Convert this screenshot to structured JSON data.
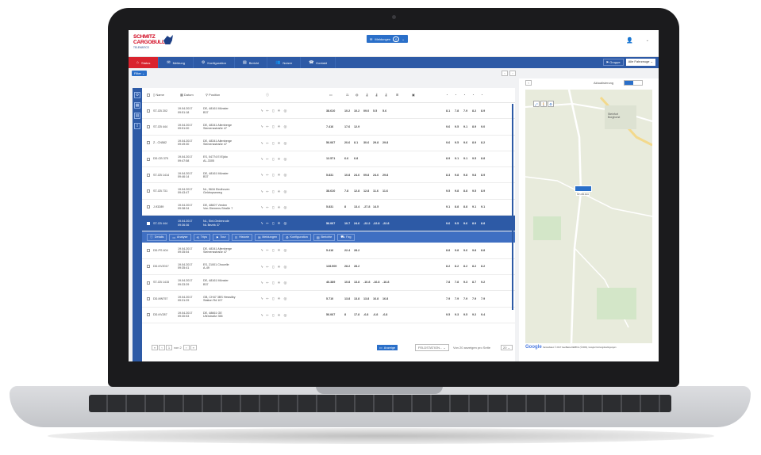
{
  "app": {
    "logo_line1": "SCHMITZ",
    "logo_line2": "CARGOBULL",
    "logo_line3": "TELEMATICS",
    "messages_label": "Meldungen",
    "messages_count": "0"
  },
  "nav": {
    "tabs": [
      {
        "label": "Status",
        "icon": "home-icon"
      },
      {
        "label": "Meldung",
        "icon": "envelope-icon"
      },
      {
        "label": "Konfiguration",
        "icon": "gear-icon"
      },
      {
        "label": "Bericht",
        "icon": "document-icon"
      },
      {
        "label": "Nutzer",
        "icon": "users-icon"
      },
      {
        "label": "Kontakt",
        "icon": "phone-icon"
      }
    ],
    "group_label": "Gruppe",
    "vehicle_select": "Alle Fahrzeuge"
  },
  "toolbar": {
    "filter_label": "Filter"
  },
  "table": {
    "headers": {
      "name": "Name",
      "date": "Datum",
      "position": "Position"
    },
    "rows": [
      {
        "name": "ST-CB 202",
        "date": "19.04.2017\n09:51:18",
        "pos": "DE, 48161 Münster\nB37",
        "odo": "38.610",
        "vals": [
          "10.2",
          "10.2",
          "09.0",
          "5.5",
          "5.6"
        ],
        "temps": [
          "8.1",
          "7.8",
          "7.9",
          "8.2",
          "8.9"
        ]
      },
      {
        "name": "ST-CB 444",
        "date": "19.04.2017\n09:51:00",
        "pos": "DE, 48341 Altenberge\nSiemensstraße 47",
        "odo": "7.416",
        "vals": [
          "17.6",
          "12.9",
          "",
          "",
          ""
        ],
        "temps": [
          "9.6",
          "9.5",
          "9.1",
          "8.9",
          "9.0"
        ]
      },
      {
        "name": "Z - CN582",
        "date": "19.04.2017\n09:49:30",
        "pos": "DE, 48341 Altenberge\nSiemensstraße 47",
        "odo": "56.067",
        "vals": [
          "20.6",
          "8.1",
          "30.6",
          "29.8",
          "29.8"
        ],
        "temps": [
          "9.6",
          "9.5",
          "9.6",
          "8.9",
          "8.2"
        ]
      },
      {
        "name": "DD-CB 375",
        "date": "19.04.2017\n09:47:58",
        "pos": "ES, 04774 El Ejido\nAL-3305",
        "odo": "12.571",
        "vals": [
          "6.6",
          "6.8",
          "",
          "",
          ""
        ],
        "temps": [
          "8.9",
          "9.1",
          "9.1",
          "9.5",
          "8.8"
        ]
      },
      {
        "name": "ST-CB 1414",
        "date": "19.04.2017\n09:46:14",
        "pos": "DE, 48161 Münster\nB37",
        "odo": "5.831",
        "vals": [
          "10.8",
          "24.6",
          "09.8",
          "24.6",
          "29.8"
        ],
        "temps": [
          "8.3",
          "9.8",
          "9.8",
          "9.8",
          "8.9"
        ]
      },
      {
        "name": "ST-CB 731",
        "date": "19.04.2017\n09:43:47",
        "pos": "NL, 5616 Eindhoven\nGeldropseweg",
        "odo": "38.610",
        "vals": [
          "7.8",
          "12.8",
          "12.8",
          "11.6",
          "11.6"
        ],
        "temps": [
          "9.5",
          "9.8",
          "8.8",
          "9.5",
          "8.9"
        ]
      },
      {
        "name": "J-93289",
        "date": "19.04.2017\n09:38:34",
        "pos": "DE, 48607 Vreden\nVon-Siemens-Straße 7",
        "odo": "5.831",
        "vals": [
          "8",
          "13.4",
          "-27.8",
          "14.5",
          ""
        ],
        "temps": [
          "9.1",
          "8.8",
          "8.8",
          "9.1",
          "9.1"
        ]
      },
      {
        "name": "ST-CB 444",
        "date": "19.04.2017\n09:36:36",
        "pos": "NL, Sint-Oedenrode\nNL Bezirk 37",
        "odo": "56.067",
        "vals": [
          "10.7",
          "24.6",
          "-22.2",
          "-22.8",
          "-22.8"
        ],
        "temps": [
          "9.6",
          "9.5",
          "9.6",
          "8.9",
          "8.8"
        ],
        "selected": true
      },
      {
        "name": "DD-PS 404",
        "date": "19.04.2017\n09:35:54",
        "pos": "DE, 48341 Altenberge\nSiemensstraße 47",
        "odo": "5.416",
        "vals": [
          "22.4",
          "28.2",
          "",
          "",
          ""
        ],
        "temps": [
          "8.8",
          "9.8",
          "9.6",
          "9.8",
          "8.8"
        ]
      },
      {
        "name": "DD-KV2017",
        "date": "19.04.2017\n09:35:41",
        "pos": "ES, 21001 Chocelle\nA-49",
        "odo": "128.909",
        "vals": [
          "28.2",
          "28.2",
          "",
          "",
          ""
        ],
        "temps": [
          "8.2",
          "8.2",
          "8.2",
          "8.2",
          "8.2"
        ]
      },
      {
        "name": "ST-CB 1415",
        "date": "19.04.2017\n09:33:29",
        "pos": "DE, 48161 Münster\nB37",
        "odo": "46.389",
        "vals": [
          "10.8",
          "13.8",
          "-10.8",
          "-16.8",
          "-16.8"
        ],
        "temps": [
          "7.8",
          "7.8",
          "9.3",
          "8.7",
          "9.2"
        ]
      },
      {
        "name": "DD-MN757",
        "date": "19.04.2017\n09:31:29",
        "pos": "GB, CH47 3BS Heswilby\nStation Rd 107",
        "odo": "5.710",
        "vals": [
          "13.8",
          "13.8",
          "13.8",
          "16.8",
          "16.8"
        ],
        "temps": [
          "7.9",
          "7.9",
          "7.9",
          "7.9",
          "7.9"
        ]
      },
      {
        "name": "DD-KV287",
        "date": "19.04.2017\n09:30:53",
        "pos": "DE, 48661 GE\nUferstraße 355",
        "odo": "56.067",
        "vals": [
          "8",
          "17.8",
          "-6.8",
          "-6.8",
          "-6.8"
        ],
        "temps": [
          "9.5",
          "9.3",
          "9.5",
          "9.2",
          "9.4"
        ]
      }
    ],
    "actions": [
      "Details",
      "Analyse",
      "Trips",
      "Tour",
      "Historie",
      "Meldungen",
      "Konfiguration",
      "Berichte",
      "Fzg"
    ]
  },
  "footer": {
    "page_value": "1",
    "page_of": "von 2",
    "show_button": "Anzeige",
    "fleet_select": "FELDSTATION...",
    "per_page_text": "Von 20 anzeigen pro Seite",
    "per_page_value": "20"
  },
  "map": {
    "current_pos_label": "Aktualisierung",
    "town": "Steinfurt\nBorghorst",
    "truck_label": "ST-CB 444",
    "google": "Google",
    "credits": "Kartendaten © 2017 GeoBasis-DE/BKG (©2009), Google    Nutzungsbedingungen"
  },
  "colors": {
    "brand_blue": "#2d5aa6",
    "accent_red": "#d9232e",
    "button_blue": "#2a6fc9"
  }
}
